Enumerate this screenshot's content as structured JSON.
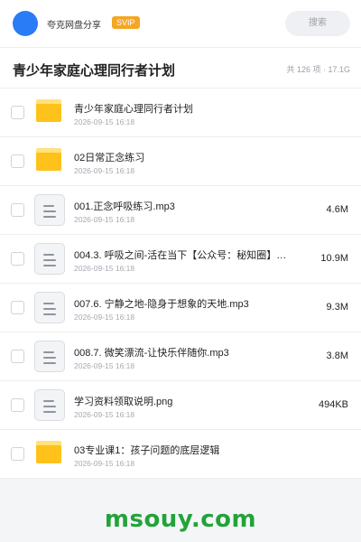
{
  "header": {
    "user_name": "夸克网盘分享",
    "vip_badge": "SVIP",
    "search_placeholder": "搜索"
  },
  "folder": {
    "title": "青少年家庭心理同行者计划",
    "meta": "共 126 项 · 17.1G"
  },
  "files": [
    {
      "name": "青少年家庭心理同行者计划",
      "date": "2026-09-15 16:18",
      "size": "",
      "type": "folder",
      "icon": "folder-icon"
    },
    {
      "name": "02日常正念练习",
      "date": "2026-09-15 16:18",
      "size": "",
      "type": "folder",
      "icon": "folder-icon"
    },
    {
      "name": "001.正念呼吸练习.mp3",
      "date": "2026-09-15 16:18",
      "size": "4.6M",
      "type": "file",
      "icon": "file-icon"
    },
    {
      "name": "004.3. 呼吸之间-活在当下【公众号：秘知圈】…",
      "date": "2026-09-15 16:18",
      "size": "10.9M",
      "type": "file",
      "icon": "file-icon"
    },
    {
      "name": "007.6. 宁静之地-隐身于想象的天地.mp3",
      "date": "2026-09-15 16:18",
      "size": "9.3M",
      "type": "file",
      "icon": "file-icon"
    },
    {
      "name": "008.7. 微笑漂流-让快乐伴随你.mp3",
      "date": "2026-09-15 16:18",
      "size": "3.8M",
      "type": "file",
      "icon": "file-icon"
    },
    {
      "name": "学习资料领取说明.png",
      "date": "2026-09-15 16:18",
      "size": "494KB",
      "type": "file",
      "icon": "file-icon"
    },
    {
      "name": "03专业课1：孩子问题的底层逻辑",
      "date": "2026-09-15 16:18",
      "size": "",
      "type": "folder",
      "icon": "folder-icon"
    }
  ],
  "watermark": "msouy.com",
  "colors": {
    "avatar": "#2a7bf6",
    "vip": "#f5a623",
    "folder": "#ffc21a",
    "watermark": "#22a33a"
  }
}
